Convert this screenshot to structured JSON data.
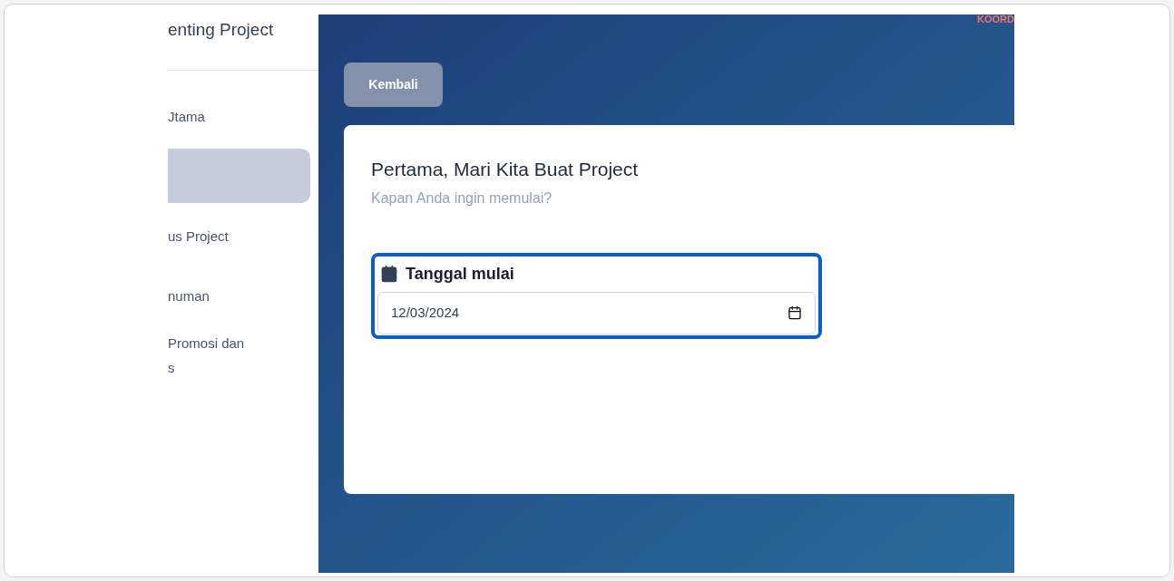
{
  "sidebar": {
    "title": "enting Project",
    "items": [
      {
        "label": "Jtama",
        "selected": false
      },
      {
        "selected": true
      },
      {
        "label": "us Project",
        "selected": false
      },
      {
        "label": "numan",
        "selected": false
      },
      {
        "label": "Promosi dan\ns",
        "selected": false
      }
    ]
  },
  "header": {
    "tag": "KOORD",
    "back_button": "Kembali"
  },
  "card": {
    "title": "Pertama, Mari Kita Buat Project",
    "subtitle": "Kapan Anda ingin memulai?",
    "field": {
      "label": "Tanggal mulai",
      "value": "12/03/2024",
      "focused": true
    }
  }
}
